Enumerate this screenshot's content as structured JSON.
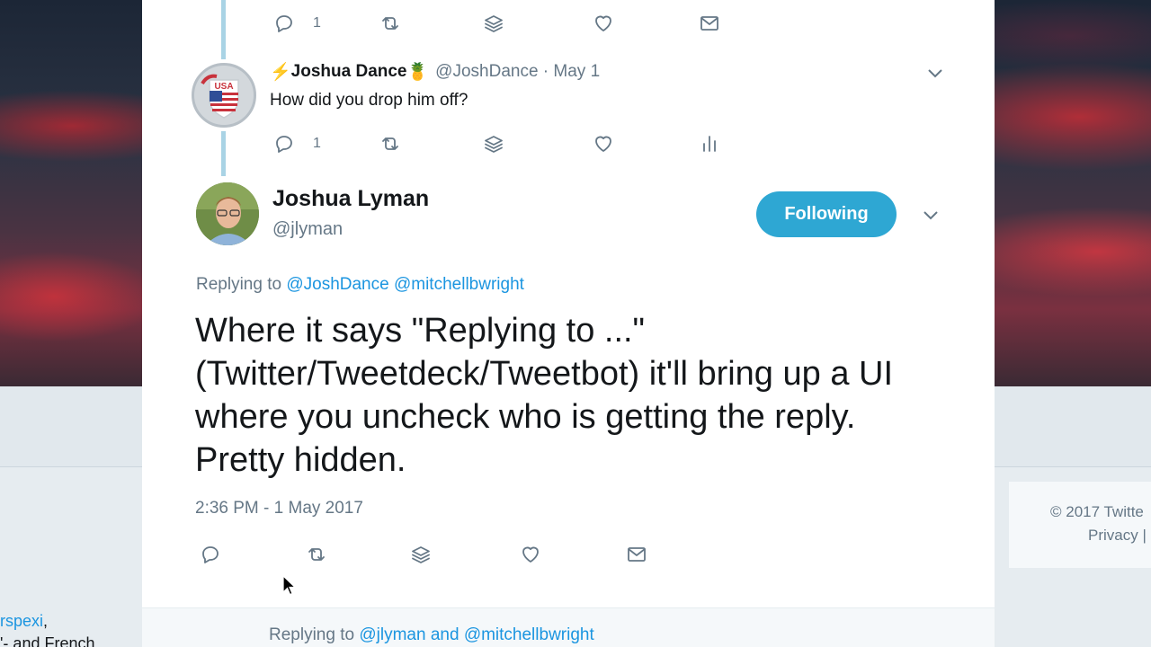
{
  "background": {
    "left_fragment_link": "rspexi",
    "left_fragment_text": ",",
    "left_fragment_line2": "'- and French",
    "copyright": "© 2017 Twitte",
    "privacy": "Privacy |"
  },
  "top_tweet_actions": {
    "reply_count": "1"
  },
  "reply_tweet": {
    "name": "Joshua Dance",
    "emoji_before": "⚡",
    "emoji_after": "🍍",
    "handle_date": "@JoshDance · May 1",
    "text": "How did you drop him off?",
    "reply_count": "1",
    "avatar_text": "USA"
  },
  "main_tweet": {
    "name": "Joshua Lyman",
    "handle": "@jlyman",
    "follow_label": "Following",
    "replying_prefix": "Replying to",
    "replying_to_1": "@JoshDance",
    "replying_to_2": "@mitchellbwright",
    "text": "Where it says \"Replying to ...\" (Twitter/Tweetdeck/Tweetbot) it'll bring up a UI where you uncheck who is getting the reply. Pretty hidden.",
    "timestamp": "2:36 PM - 1 May 2017"
  },
  "reply_compose": {
    "prefix": "Replying to",
    "user_1": "@jlyman",
    "joiner": "and",
    "user_2": "@mitchellbwright"
  },
  "colors": {
    "accent": "#2ea7d3",
    "link": "#1b95e0",
    "muted": "#657786",
    "thread_line": "#a9d3e5"
  }
}
